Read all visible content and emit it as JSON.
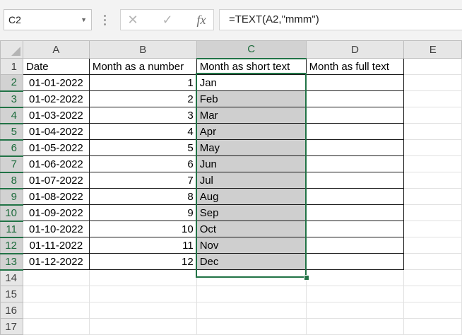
{
  "formula_bar": {
    "name_box": "C2",
    "cancel_icon": "✕",
    "enter_icon": "✓",
    "fx_label": "fx",
    "formula": "=TEXT(A2,\"mmm\")"
  },
  "columns": [
    "A",
    "B",
    "C",
    "D",
    "E"
  ],
  "selected_column": "C",
  "row_numbers": [
    "1",
    "2",
    "3",
    "4",
    "5",
    "6",
    "7",
    "8",
    "9",
    "10",
    "11",
    "12",
    "13",
    "14",
    "15",
    "16",
    "17"
  ],
  "headers": {
    "a": "Date",
    "b": "Month as a number",
    "c": "Month as short text",
    "d": "Month as full text"
  },
  "rows": [
    {
      "date": "01-01-2022",
      "num": "1",
      "short": "Jan"
    },
    {
      "date": "01-02-2022",
      "num": "2",
      "short": "Feb"
    },
    {
      "date": "01-03-2022",
      "num": "3",
      "short": "Mar"
    },
    {
      "date": "01-04-2022",
      "num": "4",
      "short": "Apr"
    },
    {
      "date": "01-05-2022",
      "num": "5",
      "short": "May"
    },
    {
      "date": "01-06-2022",
      "num": "6",
      "short": "Jun"
    },
    {
      "date": "01-07-2022",
      "num": "7",
      "short": "Jul"
    },
    {
      "date": "01-08-2022",
      "num": "8",
      "short": "Aug"
    },
    {
      "date": "01-09-2022",
      "num": "9",
      "short": "Sep"
    },
    {
      "date": "01-10-2022",
      "num": "10",
      "short": "Oct"
    },
    {
      "date": "01-11-2022",
      "num": "11",
      "short": "Nov"
    },
    {
      "date": "01-12-2022",
      "num": "12",
      "short": "Dec"
    }
  ],
  "colors": {
    "selection": "#217346",
    "selected_fill": "#cfcfcf",
    "header_bg": "#e6e6e6"
  }
}
